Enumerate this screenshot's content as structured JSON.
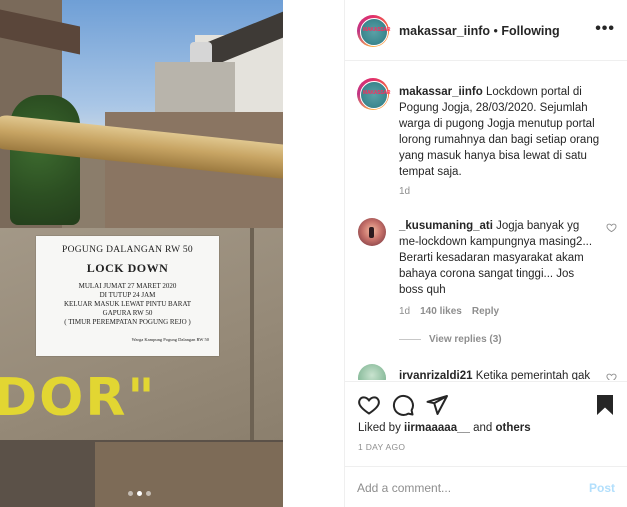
{
  "photo": {
    "notice": {
      "title": "POGUNG DALANGAN RW 50",
      "heading": "LOCK DOWN",
      "lines": [
        "MULAI JUMAT 27 MARET 2020",
        "DI TUTUP 24 JAM",
        "KELUAR MASUK LEWAT PINTU BARAT",
        "GAPURA RW 50",
        "( TIMUR PEREMPATAN POGUNG REJO )"
      ],
      "signature": "Warga Kampung Pogung Dalangan RW 50"
    },
    "graffiti_text": "DOR\"",
    "carousel": {
      "total": 3,
      "active": 2
    }
  },
  "header": {
    "username": "makassar_iinfo",
    "separator": " • ",
    "follow_status": "Following",
    "more_label": "•••",
    "avatar_text": "MAKASSAR"
  },
  "caption": {
    "username": "makassar_iinfo",
    "text": "Lockdown portal di Pogung Jogja, 28/03/2020. Sejumlah warga di pugong Jogja menutup portal lorong rumahnya dan bagi setiap orang yang masuk hanya bisa lewat di satu tempat saja.",
    "time": "1d"
  },
  "comments": [
    {
      "username": "_kusumaning_ati",
      "text": "Jogja banyak yg me-lockdown kampungnya masing2... Berarti kesadaran masyarakat akam bahaya corona sangat tinggi... Jos boss quh",
      "time": "1d",
      "likes": "140 likes",
      "reply_label": "Reply",
      "view_replies": "View replies (3)"
    },
    {
      "username": "irvanrizaldi21",
      "text": "Ketika pemerintah gak"
    }
  ],
  "likes": {
    "prefix": "Liked by ",
    "user": "iirmaaaaa__",
    "middle": " and ",
    "others": "others"
  },
  "post_date": "1 DAY AGO",
  "comment_input": {
    "placeholder": "Add a comment...",
    "post_label": "Post"
  },
  "icons": {
    "like": "heart-icon",
    "comment": "comment-icon",
    "share": "paper-plane-icon",
    "save": "bookmark-icon"
  }
}
